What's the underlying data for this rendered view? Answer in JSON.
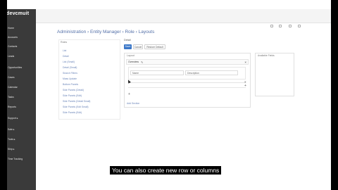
{
  "app": {
    "logo_text": "devcmuit"
  },
  "sidebar": {
    "items": [
      {
        "label": "Home"
      },
      {
        "label": "Accounts"
      },
      {
        "label": "Contacts"
      },
      {
        "label": "Leads"
      },
      {
        "label": "Opportunities"
      },
      {
        "label": "Cases"
      },
      {
        "label": "Calendar"
      },
      {
        "label": "Tasks"
      },
      {
        "label": "Reports"
      },
      {
        "label": "Support ▸"
      },
      {
        "label": "Sale ▸"
      },
      {
        "label": "Tools ▸"
      },
      {
        "label": "Ship ▸"
      },
      {
        "label": "Time Tracking"
      }
    ]
  },
  "breadcrumb": "Administration › Entity Manager › Role › Layouts",
  "left_panel": {
    "header": "Roles",
    "items": [
      "List",
      "Detail",
      "List (Small)",
      "Detail (Small)",
      "Search Filters",
      "Mass Update",
      "Bottom Panels",
      "Side Panels (Detail)",
      "Side Panels (Edit)",
      "Side Panels (Detail Small)",
      "Side Panels (Edit Small)",
      "Side Panels (Edit)"
    ]
  },
  "detail": {
    "label": "Detail",
    "buttons": {
      "save": "Save",
      "cancel": "Cancel",
      "restore": "Restore Default"
    },
    "layout_title": "Layout",
    "tab_label": "Overview",
    "fields": {
      "name": "Name",
      "description": "Description"
    },
    "add_section": "Add Section"
  },
  "available": {
    "title": "Available Fields"
  },
  "caption": "You can also create new row or columns"
}
